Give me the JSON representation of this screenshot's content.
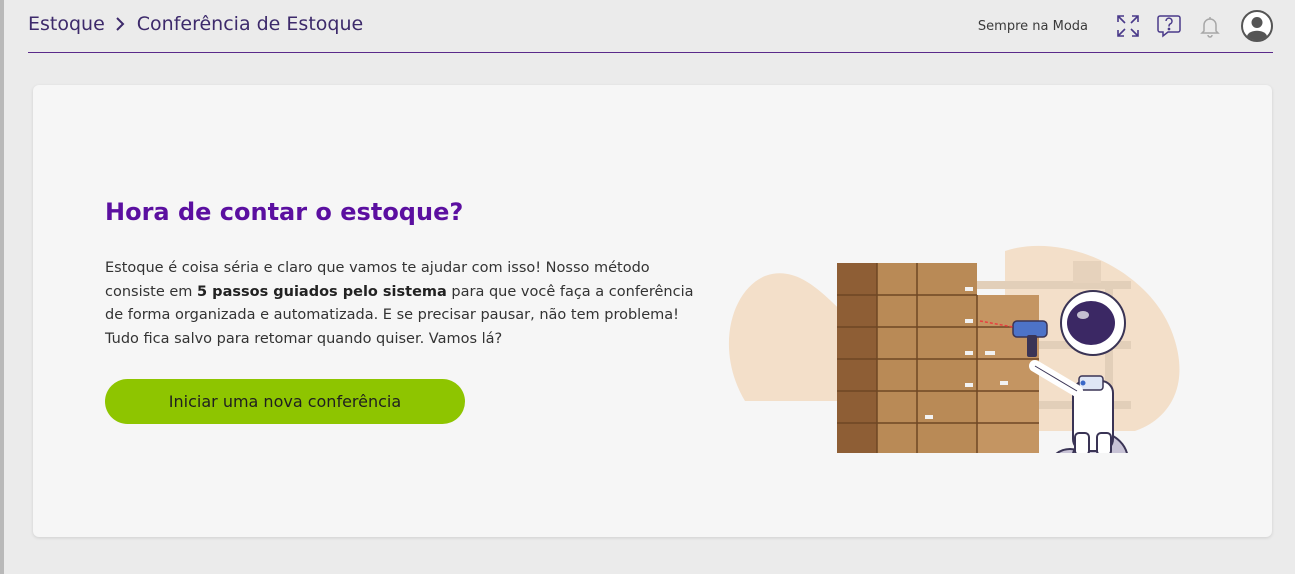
{
  "header": {
    "breadcrumb": {
      "root": "Estoque",
      "current": "Conferência de Estoque"
    },
    "store_name": "Sempre na Moda",
    "icons": [
      "expand-icon",
      "help-icon",
      "bell-icon",
      "user-avatar-icon"
    ],
    "accent_color": "#5a2a8a"
  },
  "main": {
    "title": "Hora de contar o estoque?",
    "paragraph": {
      "part1": "Estoque é coisa séria e claro que vamos te ajudar com isso! Nosso método consiste em ",
      "bold": "5 passos guiados pelo sistema",
      "part2": " para que você faça a conferência de forma organizada e automatizada. E se precisar pausar, não tem problema! Tudo fica salvo para retomar quando quiser. Vamos lá?"
    },
    "cta_label": "Iniciar uma nova conferência",
    "title_color": "#5b0fa0",
    "cta_color": "#8ec500",
    "illustration": "astronaut-scanning-boxes"
  }
}
